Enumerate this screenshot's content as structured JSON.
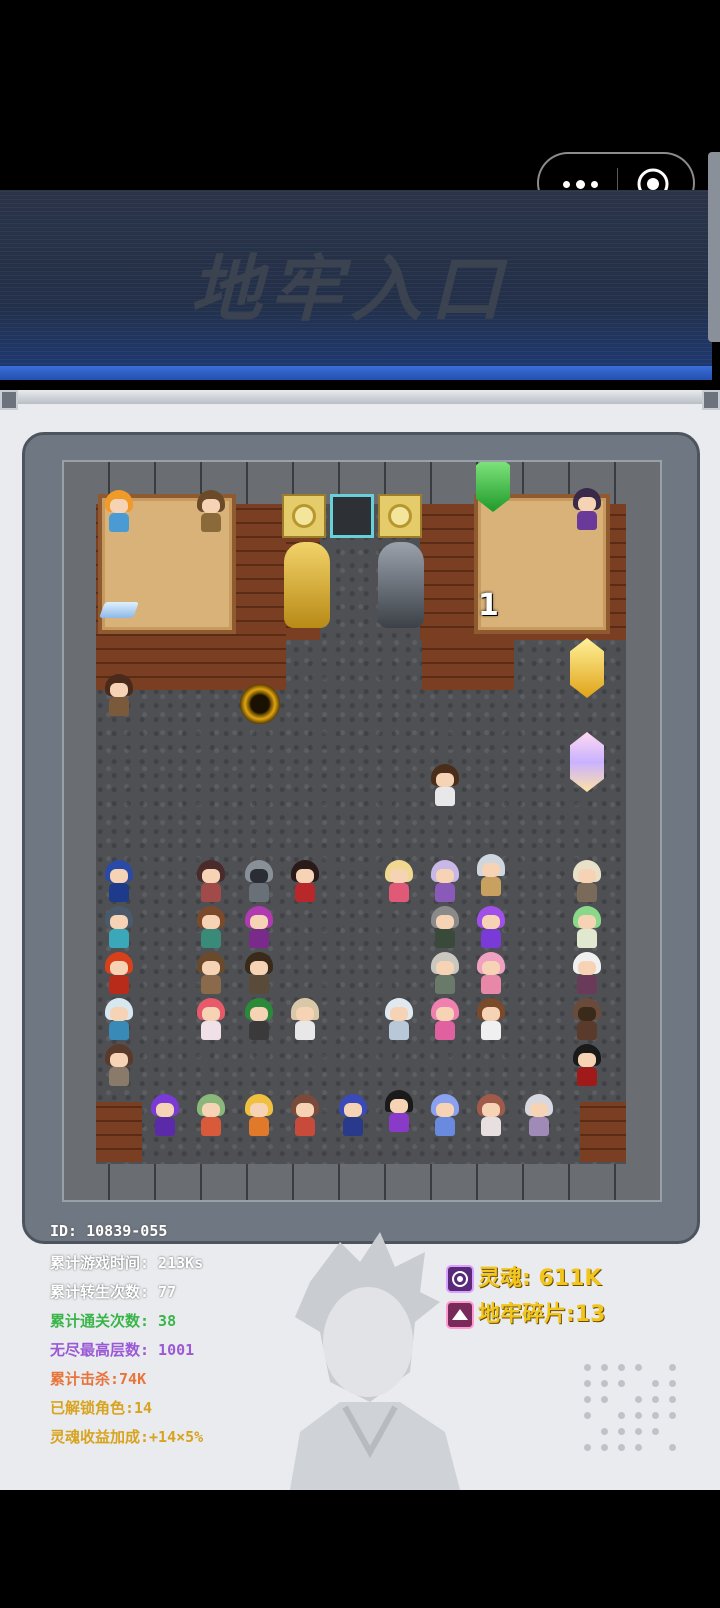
{
  "header": {
    "title": "地牢入口"
  },
  "capsule": {
    "more_icon": "more-dots-icon",
    "close_icon": "target-close-icon"
  },
  "dungeon": {
    "floor_marker": "1"
  },
  "stats": {
    "id": "ID: 10839-055",
    "play_time": "累计游戏时间: 213Ks",
    "rebirths": "累计转生次数: 77",
    "clears": "累计通关次数: 38",
    "endless_max": "无尽最高层数: 1001",
    "kills": "累计击杀:74K",
    "unlocked": "已解锁角色:14",
    "soul_bonus": "灵魂收益加成:+14×5%"
  },
  "resources": {
    "soul_label": "灵魂: 611K",
    "shard_label": "地牢碎片:13"
  },
  "colors": {
    "green_stat": "#39b54a",
    "purple_stat": "#9b59d6",
    "orange_stat": "#e8743a",
    "gold_stat": "#d8a420",
    "resource_text": "#f2c51c"
  }
}
